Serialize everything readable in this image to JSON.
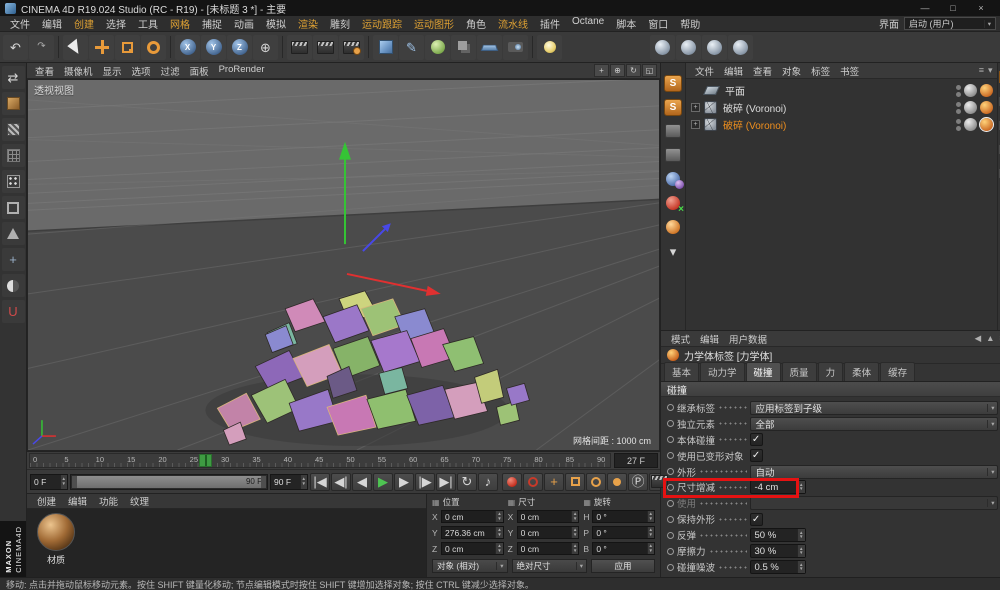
{
  "window": {
    "title": "CINEMA 4D R19.024 Studio (RC - R19) - [未标题 3 *] - 主要",
    "controls": [
      {
        "name": "minimize-icon",
        "glyph": "—"
      },
      {
        "name": "maximize-icon",
        "glyph": "□"
      },
      {
        "name": "close-icon",
        "glyph": "×"
      }
    ]
  },
  "menubar": {
    "items": [
      {
        "label": "文件"
      },
      {
        "label": "编辑"
      },
      {
        "label": "创建",
        "accent": true
      },
      {
        "label": "选择"
      },
      {
        "label": "工具"
      },
      {
        "label": "网格",
        "accent": true
      },
      {
        "label": "捕捉"
      },
      {
        "label": "动画"
      },
      {
        "label": "模拟"
      },
      {
        "label": "渲染",
        "accent": true
      },
      {
        "label": "雕刻"
      },
      {
        "label": "运动跟踪",
        "accent": true
      },
      {
        "label": "运动图形",
        "accent": true
      },
      {
        "label": "角色"
      },
      {
        "label": "流水线",
        "accent": true
      },
      {
        "label": "插件"
      },
      {
        "label": "Octane"
      },
      {
        "label": "脚本"
      },
      {
        "label": "窗口"
      },
      {
        "label": "帮助"
      }
    ],
    "right_label": "界面",
    "layout_value": "启动 (用户)"
  },
  "toolbar": {
    "icons": [
      {
        "name": "undo-icon",
        "glyph": "↶"
      },
      {
        "name": "redo-icon",
        "glyph": "↷",
        "small": true
      },
      {
        "name": "divider",
        "kind": "divider"
      },
      {
        "name": "live-selection-icon",
        "kind": "cursor"
      },
      {
        "name": "move-tool-icon",
        "kind": "move"
      },
      {
        "name": "scale-tool-icon",
        "kind": "scale"
      },
      {
        "name": "rotate-tool-icon",
        "kind": "rotate"
      },
      {
        "name": "divider",
        "kind": "divider"
      },
      {
        "name": "x-axis-lock-icon",
        "kind": "axis",
        "letter": "X"
      },
      {
        "name": "y-axis-lock-icon",
        "kind": "axis",
        "letter": "Y"
      },
      {
        "name": "z-axis-lock-icon",
        "kind": "axis",
        "letter": "Z"
      },
      {
        "name": "coordinate-system-icon",
        "glyph": "⊕"
      },
      {
        "name": "divider",
        "kind": "divider"
      },
      {
        "name": "render-view-icon",
        "kind": "clapper"
      },
      {
        "name": "render-region-icon",
        "kind": "clapper"
      },
      {
        "name": "render-settings-icon",
        "kind": "clapper clapper-gear"
      },
      {
        "name": "divider",
        "kind": "divider"
      },
      {
        "name": "primitive-cube-icon",
        "kind": "cube"
      },
      {
        "name": "pen-tool-icon",
        "glyph": "✎",
        "color": "#9fc3e8"
      },
      {
        "name": "subdivision-surface-icon",
        "kind": "green-ball"
      },
      {
        "name": "boole-icon",
        "kind": "gray-cubes"
      },
      {
        "name": "floor-icon",
        "kind": "floor"
      },
      {
        "name": "camera-icon",
        "kind": "cam"
      },
      {
        "name": "divider",
        "kind": "divider"
      },
      {
        "name": "light-tool-icon",
        "kind": "bulb"
      }
    ],
    "palette": [
      {
        "name": "material-ball-icon",
        "kind": "ball"
      },
      {
        "name": "material-ball-icon",
        "kind": "ball"
      },
      {
        "name": "material-ball-icon",
        "kind": "ball"
      },
      {
        "name": "material-ball-icon",
        "kind": "ball"
      }
    ]
  },
  "left_toolbar": {
    "icons": [
      {
        "name": "make-editable-icon",
        "glyph": "⇄"
      },
      {
        "name": "model-mode-icon",
        "kind": "cube-o"
      },
      {
        "name": "texture-mode-icon",
        "kind": "checker"
      },
      {
        "name": "workplane-icon",
        "kind": "grid"
      },
      {
        "name": "points-mode-icon",
        "kind": "points"
      },
      {
        "name": "edges-mode-icon",
        "kind": "edges"
      },
      {
        "name": "polygons-mode-icon",
        "kind": "poly"
      },
      {
        "name": "enable-axis-icon",
        "glyph": "+",
        "color": "#9ab0c8"
      },
      {
        "name": "viewport-solo-icon",
        "kind": "solo"
      },
      {
        "name": "snap-icon",
        "glyph": "U",
        "color": "#d04a4a"
      }
    ]
  },
  "branding": {
    "line1": "MAXON",
    "line2": "CINEMA4D"
  },
  "viewport": {
    "menu": [
      "查看",
      "摄像机",
      "显示",
      "选项",
      "过滤",
      "面板",
      "ProRender"
    ],
    "nav_icons": [
      {
        "name": "pan-view-icon",
        "glyph": "+"
      },
      {
        "name": "zoom-view-icon",
        "glyph": "⊕"
      },
      {
        "name": "rotate-view-icon",
        "glyph": "↻"
      },
      {
        "name": "toggle-view-icon",
        "glyph": "◱"
      }
    ],
    "view_label": "透视视图",
    "grid_info": "网格间距 : 1000 cm"
  },
  "timeline": {
    "ticks": [
      "0",
      "5",
      "10",
      "15",
      "20",
      "25",
      "30",
      "35",
      "40",
      "45",
      "50",
      "55",
      "60",
      "65",
      "70",
      "75",
      "80",
      "85",
      "90"
    ],
    "current": "27 F",
    "current_frame": 27,
    "frames_total": 90
  },
  "transport": {
    "start_value": "0 F",
    "end_value": "90 F",
    "buttons": [
      {
        "name": "goto-start-icon",
        "glyph": "|◀"
      },
      {
        "name": "prev-key-icon",
        "glyph": "◀|"
      },
      {
        "name": "prev-frame-icon",
        "glyph": "◀"
      },
      {
        "name": "play-icon",
        "glyph": "▶",
        "color": "#4ec452"
      },
      {
        "name": "next-frame-icon",
        "glyph": "▶"
      },
      {
        "name": "next-key-icon",
        "glyph": "|▶"
      },
      {
        "name": "goto-end-icon",
        "glyph": "▶|"
      },
      {
        "name": "loop-mode-icon",
        "glyph": "↻"
      },
      {
        "name": "sound-icon",
        "glyph": "♪"
      }
    ],
    "record_buttons": [
      {
        "name": "record-keyframe-icon",
        "kind": "red-dot"
      },
      {
        "name": "autokey-icon",
        "kind": "red-ring"
      },
      {
        "name": "record-position-icon",
        "glyph": "+",
        "color": "#e8a24a"
      },
      {
        "name": "record-scale-icon",
        "kind": "orange-box"
      },
      {
        "name": "record-rotation-icon",
        "kind": "orange-ring"
      },
      {
        "name": "record-parameter-icon",
        "kind": "orange-dot"
      },
      {
        "name": "record-point-level-icon",
        "glyph": "Ⓟ"
      },
      {
        "name": "render-marker-icon",
        "kind": "clapper"
      }
    ]
  },
  "material_panel": {
    "menu": [
      "创建",
      "编辑",
      "功能",
      "纹理"
    ],
    "materials": [
      {
        "name": "材质"
      }
    ]
  },
  "coord_panel": {
    "groups": [
      {
        "title": "位置",
        "rows": [
          {
            "axis": "X",
            "value": "0 cm"
          },
          {
            "axis": "Y",
            "value": "276.36 cm"
          },
          {
            "axis": "Z",
            "value": "0 cm"
          }
        ]
      },
      {
        "title": "尺寸",
        "rows": [
          {
            "axis": "X",
            "value": "0 cm"
          },
          {
            "axis": "Y",
            "value": "0 cm"
          },
          {
            "axis": "Z",
            "value": "0 cm"
          }
        ]
      },
      {
        "title": "旋转",
        "rows": [
          {
            "axis": "H",
            "value": "0 °"
          },
          {
            "axis": "P",
            "value": "0 °"
          },
          {
            "axis": "B",
            "value": "0 °"
          }
        ]
      }
    ],
    "mode_select": "对象 (相对)",
    "size_select": "绝对尺寸",
    "apply_button": "应用"
  },
  "sim_palette": {
    "icons": [
      {
        "name": "sculpt-layer-icon",
        "kind": "sbadge",
        "letter": "S"
      },
      {
        "name": "sculpt-mask-icon",
        "kind": "sbadge",
        "letter": "S"
      },
      {
        "name": "cloth-icon",
        "kind": "gray-tool"
      },
      {
        "name": "hair-icon",
        "kind": "gray-tool"
      },
      {
        "name": "rigid-body-icon",
        "kind": "balls-blue"
      },
      {
        "name": "collider-body-icon",
        "kind": "ball-red-x"
      },
      {
        "name": "soft-body-icon",
        "kind": "ball-orange"
      },
      {
        "name": "more-icon",
        "glyph": "▾"
      }
    ]
  },
  "side_tabs": {
    "icons": [
      {
        "name": "layers-tab-icon",
        "kind": "orange-doc"
      },
      {
        "name": "scene-tab-icon",
        "kind": "gray-sq"
      },
      {
        "name": "browser-tab-icon",
        "kind": "gray-sq"
      },
      {
        "name": "structure-tab-icon",
        "kind": "gray-sq"
      },
      {
        "name": "info-tab-icon",
        "kind": "gray-sq"
      }
    ]
  },
  "object_manager": {
    "menu": [
      "文件",
      "编辑",
      "查看",
      "对象",
      "标签",
      "书签"
    ],
    "right_icons": [
      {
        "name": "om-filter-icon",
        "glyph": "≡"
      },
      {
        "name": "om-search-icon",
        "glyph": "▾"
      }
    ],
    "objects": [
      {
        "name": "平面",
        "icon": "plane",
        "expander": false,
        "selected": false,
        "tags": [
          "phong-tag",
          "dynamics-tag"
        ]
      },
      {
        "name": "破碎 (Voronoi)",
        "icon": "voronoi",
        "expander": true,
        "selected": false,
        "tags": [
          "phong-tag",
          "dynamics-tag"
        ]
      },
      {
        "name": "破碎 (Voronoi)",
        "icon": "voronoi",
        "expander": true,
        "selected": true,
        "tags": [
          "phong-tag",
          "dynamics-tag"
        ]
      }
    ]
  },
  "attributes": {
    "menu": [
      "模式",
      "编辑",
      "用户数据"
    ],
    "right_icons": [
      {
        "name": "history-back-icon",
        "glyph": "◀"
      },
      {
        "name": "history-up-icon",
        "glyph": "▲"
      },
      {
        "name": "attr-options-icon",
        "glyph": "≡"
      }
    ],
    "title": "力学体标签 [力学体]",
    "tabs": [
      {
        "label": "基本"
      },
      {
        "label": "动力学"
      },
      {
        "label": "碰撞",
        "active": true
      },
      {
        "label": "质量"
      },
      {
        "label": "力"
      },
      {
        "label": "柔体"
      },
      {
        "label": "缓存"
      }
    ],
    "section": "碰撞",
    "rows": [
      {
        "label": "继承标签",
        "type": "select",
        "value": "应用标签到子级"
      },
      {
        "label": "独立元素",
        "type": "select",
        "value": "全部"
      },
      {
        "label": "本体碰撞",
        "type": "check",
        "checked": true
      },
      {
        "label": "使用已变形对象",
        "type": "check",
        "checked": true
      },
      {
        "label": "外形",
        "type": "select",
        "value": "自动"
      },
      {
        "label": "尺寸增减",
        "type": "number",
        "value": "-4 cm",
        "highlight": true
      },
      {
        "label": "使用",
        "type": "select",
        "value": "",
        "disabled": true
      },
      {
        "label": "保持外形",
        "type": "check",
        "checked": true
      },
      {
        "label": "反弹",
        "type": "number",
        "value": "50 %"
      },
      {
        "label": "摩擦力",
        "type": "number",
        "value": "30 %"
      },
      {
        "label": "碰撞噪波",
        "type": "number",
        "value": "0.5 %"
      }
    ]
  },
  "statusbar": {
    "text": "移动: 点击并拖动鼠标移动元素。按住 SHIFT 键量化移动; 节点编辑模式时按住 SHIFT 键增加选择对象; 按住 CTRL 键减少选择对象。"
  }
}
